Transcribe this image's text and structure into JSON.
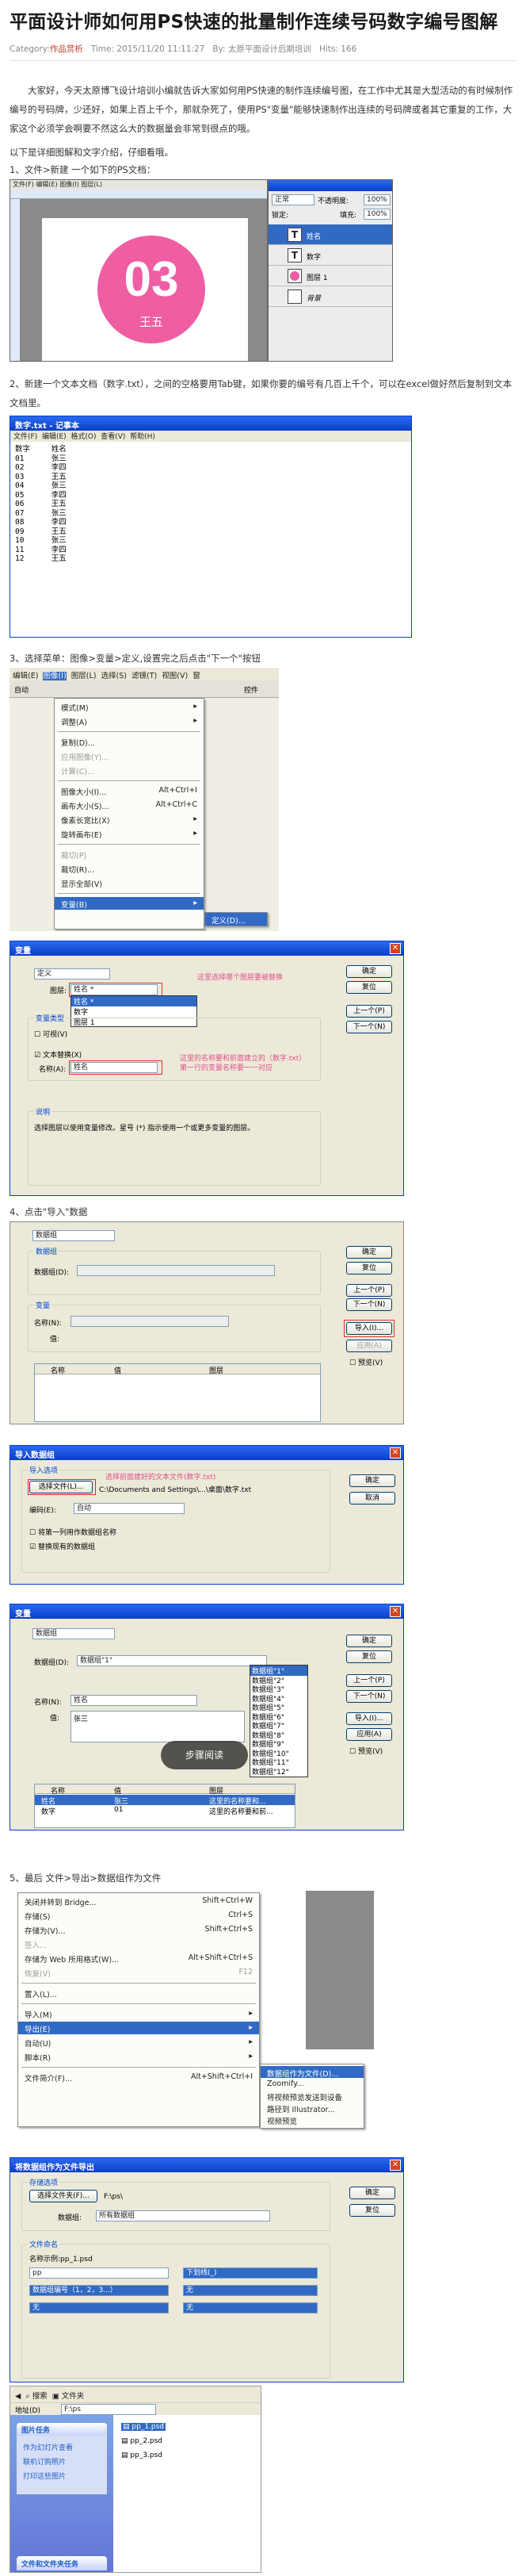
{
  "article": {
    "title": "平面设计师如何用PS快速的批量制作连续号码数字编号图解",
    "category_label": "Category:",
    "category": "作品赏析",
    "time_label": "Time:",
    "time": "2015/11/20 11:11:27",
    "by_label": "By:",
    "author": "太原平面设计后期培训",
    "hits_label": "Hits:",
    "hits": "166",
    "intro": "大家好，今天太原博飞设计培训小编就告诉大家如何用PS快速的制作连续编号图，在工作中尤其是大型活动的有时候制作编号的号码牌，少还好，如果上百上千个，那就杂死了，使用PS\"变量\"能够快速制作出连续的号码牌或者其它重复的工作，大家这个必须学会啊要不然这么大的数据量会非常到很点的哦。",
    "intro2": "以下是详细图解和文字介绍，仔细看哦。",
    "step1": "1、文件>新建 一个如下的PS文档：",
    "step2": "2、新建一个文本文档（数字.txt），之间的空格要用Tab键，如果你要的编号有几百上千个，可以在excel做好然后复制到文本文档里。",
    "step3": "3、选择菜单：图像>变量>定义,设置完之后点击\"下一个\"按钮",
    "step4": "4、点击\"导入\"数据",
    "step5": "5、最后 文件>导出>数据组作为文件"
  },
  "s1": {
    "badge_number": "03",
    "badge_name": "王五",
    "layers": [
      "姓名",
      "数字",
      "图层 1",
      "背景"
    ],
    "mode": "正常",
    "opacity_label": "不透明度:",
    "opacity": "100%",
    "fill_label": "填充:",
    "fill": "100%",
    "lock_label": "锁定:",
    "t_glyph": "T",
    "menu_items": [
      "文件(F)",
      "编辑(E)",
      "图像(I)",
      "图层(L)",
      "选择(S)",
      "滤镜(T)",
      "视图(V)",
      "窗口(W)",
      "帮助(H)"
    ]
  },
  "s2": {
    "titlebar": "数字.txt - 记事本",
    "menu": [
      "文件(F)",
      "编辑(E)",
      "格式(O)",
      "查看(V)",
      "帮助(H)"
    ],
    "text": "数字\t姓名\n01\t张三\n02\t李四\n03\t王五\n04\t张三\n05\t李四\n06\t王五\n07\t张三\n08\t李四\n09\t王五\n10\t张三\n11\t李四\n12\t王五"
  },
  "s3": {
    "menubar": [
      "编辑(E)",
      "图像(I)",
      "图层(L)",
      "选择(S)",
      "滤镜(T)",
      "视图(V)",
      "窗"
    ],
    "toolbar_label": "自动",
    "toolbar_right": "控件",
    "items": [
      {
        "label": "模式(M)",
        "sc": "▸",
        "dis": false,
        "sel": false
      },
      {
        "label": "调整(A)",
        "sc": "▸",
        "dis": false,
        "sel": false
      },
      {
        "label": "复制(D)...",
        "sc": "",
        "dis": false,
        "sel": false
      },
      {
        "label": "应用图像(Y)...",
        "sc": "",
        "dis": true,
        "sel": false
      },
      {
        "label": "计算(C)...",
        "sc": "",
        "dis": true,
        "sel": false
      },
      {
        "label": "图像大小(I)...",
        "sc": "Alt+Ctrl+I",
        "dis": false,
        "sel": false
      },
      {
        "label": "画布大小(S)...",
        "sc": "Alt+Ctrl+C",
        "dis": false,
        "sel": false
      },
      {
        "label": "像素长宽比(X)",
        "sc": "▸",
        "dis": false,
        "sel": false
      },
      {
        "label": "旋转画布(E)",
        "sc": "▸",
        "dis": false,
        "sel": false
      },
      {
        "label": "裁切(P)",
        "sc": "",
        "dis": true,
        "sel": false
      },
      {
        "label": "裁切(R)...",
        "sc": "",
        "dis": false,
        "sel": false
      },
      {
        "label": "显示全部(V)",
        "sc": "",
        "dis": false,
        "sel": false
      },
      {
        "label": "变量(B)",
        "sc": "▸",
        "dis": false,
        "sel": true
      }
    ],
    "submenu": "定义(D)..."
  },
  "dlg_vars": {
    "title": "变量",
    "select": "定义",
    "layer_label": "图层:",
    "layer_value": "姓名 *",
    "options": [
      "姓名 *",
      "数字",
      "图层 1"
    ],
    "group_title": "变量类型",
    "visible_label": "可视(V)",
    "visible_name_label": "名称:",
    "text_replace_label": "文本替换(X)",
    "text_name_label": "名称(A):",
    "text_name_value": "姓名",
    "note1": "这里选择哪个图层要被替换",
    "note2": "这里的名称要和前面建立的（数字.txt）\n第一行的变量名称要一一对应",
    "desc_title": "说明",
    "desc": "选择图层以使用变量修改。星号 (*) 指示使用一个或更多变量的图层。",
    "buttons": [
      "确定",
      "复位",
      "上一个(P)",
      "下一个(N)"
    ]
  },
  "dlg_ds": {
    "title": "变量",
    "select": "数据组",
    "group_title": "数据组",
    "ds_label": "数据组(D):",
    "var_title": "变量",
    "name_label": "名称(N):",
    "value_label": "值:",
    "col_name": "名称",
    "col_value": "值",
    "col_layer": "图层",
    "buttons": [
      "确定",
      "复位",
      "上一个(P)",
      "下一个(N)",
      "导入(I)...",
      "应用(A)",
      "预览(V)"
    ]
  },
  "dlg_import": {
    "title": "导入数据组",
    "group_title": "导入选项",
    "choose_btn": "选择文件(L)...",
    "path": "C:\\Documents and Settings\\...\\桌面\\数字.txt",
    "note": "选择前面建好的文本文件(数字.txt)",
    "enc_label": "编码(E):",
    "enc_value": "自动",
    "opt1": "将第一列用作数据组名称",
    "opt2": "替换现有的数据组",
    "buttons": [
      "确定",
      "取消"
    ]
  },
  "dlg_ds2": {
    "title": "变量",
    "select": "数据组",
    "ds_value": "数据组\"1\"",
    "list": [
      "数据组\"1\"",
      "数据组\"2\"",
      "数据组\"3\"",
      "数据组\"4\"",
      "数据组\"5\"",
      "数据组\"6\"",
      "数据组\"7\"",
      "数据组\"8\"",
      "数据组\"9\"",
      "数据组\"10\"",
      "数据组\"11\"",
      "数据组\"12\""
    ],
    "name_value": "姓名",
    "value_value": "张三",
    "overlay": "步骤阅读",
    "rows": [
      [
        "姓名",
        "张三",
        "这里的名称要和..."
      ],
      [
        "数字",
        "01",
        "这里的名称要和前..."
      ]
    ],
    "col_name": "名称",
    "col_value": "值",
    "col_layer": "图层",
    "buttons": [
      "确定",
      "复位",
      "上一个(P)",
      "下一个(N)",
      "导入(I)...",
      "应用(A)",
      "预览(V)"
    ]
  },
  "s5": {
    "items": [
      {
        "label": "关闭并转到 Bridge...",
        "sc": "Shift+Ctrl+W",
        "dis": false,
        "sel": false
      },
      {
        "label": "存储(S)",
        "sc": "Ctrl+S",
        "dis": false,
        "sel": false
      },
      {
        "label": "存储为(V)...",
        "sc": "Shift+Ctrl+S",
        "dis": false,
        "sel": false
      },
      {
        "label": "签入...",
        "sc": "",
        "dis": true,
        "sel": false
      },
      {
        "label": "存储为 Web 所用格式(W)...",
        "sc": "Alt+Shift+Ctrl+S",
        "dis": false,
        "sel": false
      },
      {
        "label": "恢复(V)",
        "sc": "F12",
        "dis": true,
        "sel": false
      },
      {
        "label": "置入(L)...",
        "sc": "",
        "dis": false,
        "sel": false
      },
      {
        "label": "导入(M)",
        "sc": "▸",
        "dis": false,
        "sel": false
      },
      {
        "label": "导出(E)",
        "sc": "▸",
        "dis": false,
        "sel": true
      },
      {
        "label": "自动(U)",
        "sc": "▸",
        "dis": false,
        "sel": false
      },
      {
        "label": "脚本(R)",
        "sc": "▸",
        "dis": false,
        "sel": false
      },
      {
        "label": "文件简介(F)...",
        "sc": "Alt+Shift+Ctrl+I",
        "dis": false,
        "sel": false
      }
    ],
    "submenu": [
      "数据组作为文件(D)...",
      "Zoomify...",
      "将视频预览发送到设备",
      "路径到 Illustrator...",
      "视频预览"
    ]
  },
  "dlg_export": {
    "title": "将数据组作为文件导出",
    "group_title": "存储选项",
    "choose_btn": "选择文件夹(F)...",
    "path": "F:\\ps\\",
    "ds_label": "数据组:",
    "ds_value": "所有数据组",
    "naming_title": "文件命名",
    "example": "名称示例:pp_1.psd",
    "name1": "pp",
    "name2": "下划线(_)",
    "name3": "数据组编号（1，2，3...）",
    "name4": "无",
    "name5": "无",
    "name6": "无",
    "buttons": [
      "确定",
      "复位"
    ]
  },
  "explorer": {
    "search": "搜索",
    "folders": "文件夹",
    "address_label": "地址(D)",
    "address": "F:\\ps",
    "panel_title": "图片任务",
    "tasks": [
      "作为幻灯片查看",
      "联机订购照片",
      "打印这些图片"
    ],
    "panel2_title": "文件和文件夹任务",
    "files": [
      "pp_1.psd",
      "pp_2.psd",
      "pp_3.psd"
    ]
  }
}
